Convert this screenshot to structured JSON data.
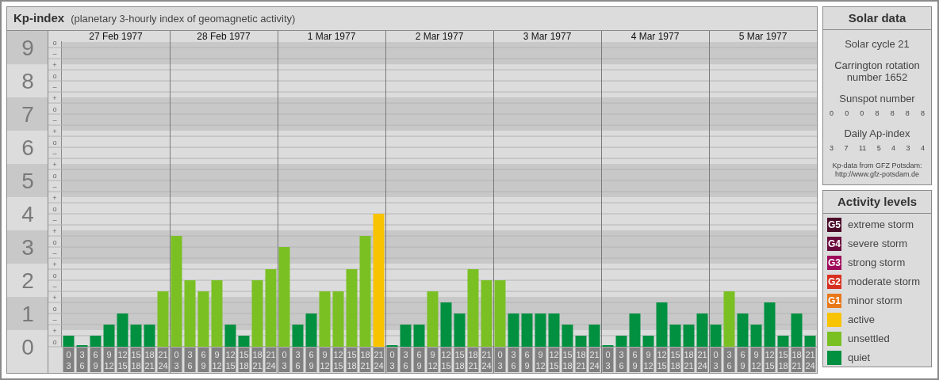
{
  "header": {
    "title": "Kp-index",
    "subtitle": "(planetary 3-hourly index of geomagnetic activity)"
  },
  "days": [
    "27 Feb 1977",
    "28 Feb 1977",
    "1 Mar 1977",
    "2 Mar 1977",
    "3 Mar 1977",
    "4 Mar 1977",
    "5 Mar 1977"
  ],
  "y_sub_labels": [
    "o",
    "–",
    "+",
    "o",
    "–",
    "+",
    "o",
    "–",
    "+",
    "o",
    "–",
    "+",
    "o",
    "–",
    "+",
    "o",
    "–",
    "+",
    "o",
    "–",
    "+",
    "o",
    "–",
    "+",
    "o",
    "–",
    "+",
    "o"
  ],
  "chart_data": {
    "type": "bar",
    "grid": true,
    "ylim": [
      0,
      9.17
    ],
    "categories": [
      "0\n3",
      "3\n6",
      "6\n9",
      "9\n12",
      "12\n15",
      "15\n18",
      "18\n21",
      "21\n24",
      "0\n3",
      "3\n6",
      "6\n9",
      "9\n12",
      "12\n15",
      "15\n18",
      "18\n21",
      "21\n24",
      "0\n3",
      "3\n6",
      "6\n9",
      "9\n12",
      "12\n15",
      "15\n18",
      "18\n21",
      "21\n24",
      "0\n3",
      "3\n6",
      "6\n9",
      "9\n12",
      "12\n15",
      "15\n18",
      "18\n21",
      "21\n24",
      "0\n3",
      "3\n6",
      "6\n9",
      "9\n12",
      "12\n15",
      "15\n18",
      "18\n21",
      "21\n24",
      "0\n3",
      "3\n6",
      "6\n9",
      "9\n12",
      "12\n15",
      "15\n18",
      "18\n21",
      "21\n24",
      "0\n3",
      "3\n6",
      "6\n9",
      "9\n12",
      "12\n15",
      "15\n18",
      "18\n21",
      "21\n24"
    ],
    "yticks": [
      0,
      1,
      2,
      3,
      4,
      5,
      6,
      7,
      8,
      9
    ],
    "series": [
      {
        "color": "#009040",
        "values": [
          0.33,
          0,
          0.33,
          0.67,
          1,
          0.67,
          0.67,
          null,
          null,
          null,
          null,
          null,
          0.67,
          0.33,
          null,
          null,
          null,
          0.67,
          1,
          null,
          null,
          null,
          null,
          null,
          0,
          0.67,
          0.67,
          null,
          1.33,
          1,
          null,
          null,
          null,
          1,
          1,
          1,
          1,
          0.67,
          0.33,
          0.67,
          0,
          0.33,
          1,
          0.33,
          1.33,
          0.67,
          0.67,
          1,
          0.67,
          null,
          1,
          0.67,
          1.33,
          0.33,
          1,
          0.33
        ]
      },
      {
        "color": "#7ac023",
        "values": [
          null,
          null,
          null,
          null,
          null,
          null,
          null,
          1.67,
          3.33,
          2,
          1.67,
          2,
          null,
          null,
          2,
          2.33,
          3,
          null,
          null,
          1.67,
          1.67,
          2.33,
          3.33,
          null,
          null,
          null,
          null,
          1.67,
          null,
          null,
          2.33,
          2,
          2,
          null,
          null,
          null,
          null,
          null,
          null,
          null,
          null,
          null,
          null,
          null,
          null,
          null,
          null,
          null,
          null,
          1.67,
          null,
          null,
          null,
          null,
          null,
          null
        ]
      },
      {
        "color": "#f8c300",
        "values": [
          null,
          null,
          null,
          null,
          null,
          null,
          null,
          null,
          null,
          null,
          null,
          null,
          null,
          null,
          null,
          null,
          null,
          null,
          null,
          null,
          null,
          null,
          null,
          4,
          null,
          null,
          null,
          null,
          null,
          null,
          null,
          null,
          null,
          null,
          null,
          null,
          null,
          null,
          null,
          null,
          null,
          null,
          null,
          null,
          null,
          null,
          null,
          null,
          null,
          null,
          null,
          null,
          null,
          null,
          null,
          null
        ]
      }
    ]
  },
  "solar_data": {
    "title": "Solar data",
    "cycle": "Solar cycle 21",
    "rotation": "Carrington rotation number 1652",
    "sunspot_label": "Sunspot number",
    "sunspot_values": [
      "0",
      "0",
      "0",
      "8",
      "8",
      "8",
      "8"
    ],
    "ap_label": "Daily Ap-index",
    "ap_values": [
      "3",
      "7",
      "11",
      "5",
      "4",
      "3",
      "4"
    ],
    "credit": "Kp-data from GFZ Potsdam:",
    "credit_url": "http://www.gfz-potsdam.de"
  },
  "activity_levels": {
    "title": "Activity levels",
    "items": [
      {
        "badge": "G5",
        "label": "extreme storm",
        "color": "#4a0a28"
      },
      {
        "badge": "G4",
        "label": "severe storm",
        "color": "#6a0a3c"
      },
      {
        "badge": "G3",
        "label": "strong storm",
        "color": "#a00a5a"
      },
      {
        "badge": "G2",
        "label": "moderate storm",
        "color": "#d83020"
      },
      {
        "badge": "G1",
        "label": "minor storm",
        "color": "#e87818"
      },
      {
        "label": "active",
        "color": "#f8c300"
      },
      {
        "label": "unsettled",
        "color": "#7ac023"
      },
      {
        "label": "quiet",
        "color": "#009040"
      }
    ]
  }
}
